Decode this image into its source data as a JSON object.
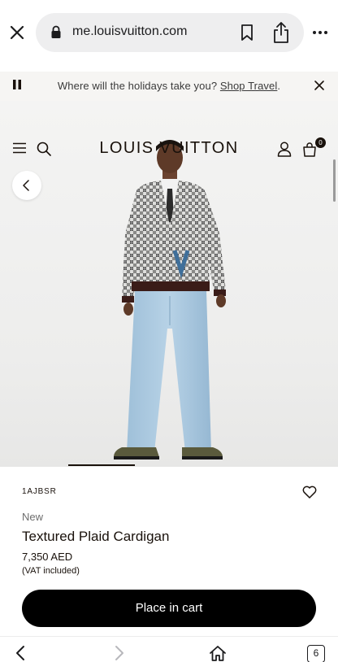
{
  "browser": {
    "url": "me.louisvuitton.com",
    "tab_count": "6"
  },
  "promo": {
    "text": "Where will the holidays take you?",
    "link": "Shop Travel",
    "suffix": "."
  },
  "header": {
    "logo": "LOUIS VUITTON",
    "bag_count": "0"
  },
  "gallery": {
    "active_index": 1
  },
  "product": {
    "sku": "1AJBSR",
    "tag": "New",
    "name": "Textured Plaid Cardigan",
    "price": "7,350 AED",
    "vat_note": "(VAT included)",
    "cta": "Place in cart"
  },
  "icons": [
    "close-icon",
    "lock-icon",
    "bookmark-icon",
    "share-icon",
    "more-icon",
    "pause-icon",
    "menu-icon",
    "search-icon",
    "account-icon",
    "bag-icon",
    "chevron-left-icon",
    "heart-icon",
    "chevron-right-icon",
    "home-icon"
  ]
}
